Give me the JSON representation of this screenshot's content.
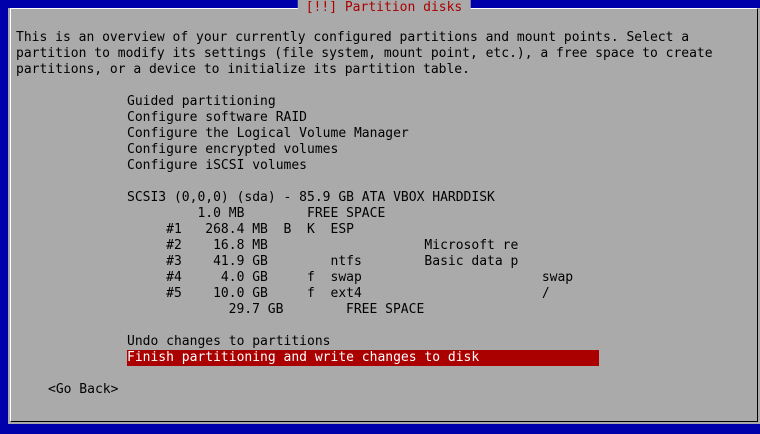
{
  "dialog": {
    "title": "[!!] Partition disks",
    "intro": [
      "This is an overview of your currently configured partitions and mount points. Select a",
      "partition to modify its settings (file system, mount point, etc.), a free space to create",
      "partitions, or a device to initialize its partition table."
    ],
    "options": [
      "Guided partitioning",
      "Configure software RAID",
      "Configure the Logical Volume Manager",
      "Configure encrypted volumes",
      "Configure iSCSI volumes"
    ],
    "disk": "SCSI3 (0,0,0) (sda) - 85.9 GB ATA VBOX HARDDISK",
    "partitions": [
      "         1.0 MB        FREE SPACE",
      "     #1   268.4 MB  B  K  ESP",
      "     #2    16.8 MB                    Microsoft re",
      "     #3    41.9 GB        ntfs        Basic data p",
      "     #4     4.0 GB     f  swap                       swap",
      "     #5    10.0 GB     f  ext4                       /",
      "        29.7 GB        FREE SPACE"
    ],
    "undo": "Undo changes to partitions",
    "finish": "Finish partitioning and write changes to disk",
    "go_back": "<Go Back>"
  }
}
